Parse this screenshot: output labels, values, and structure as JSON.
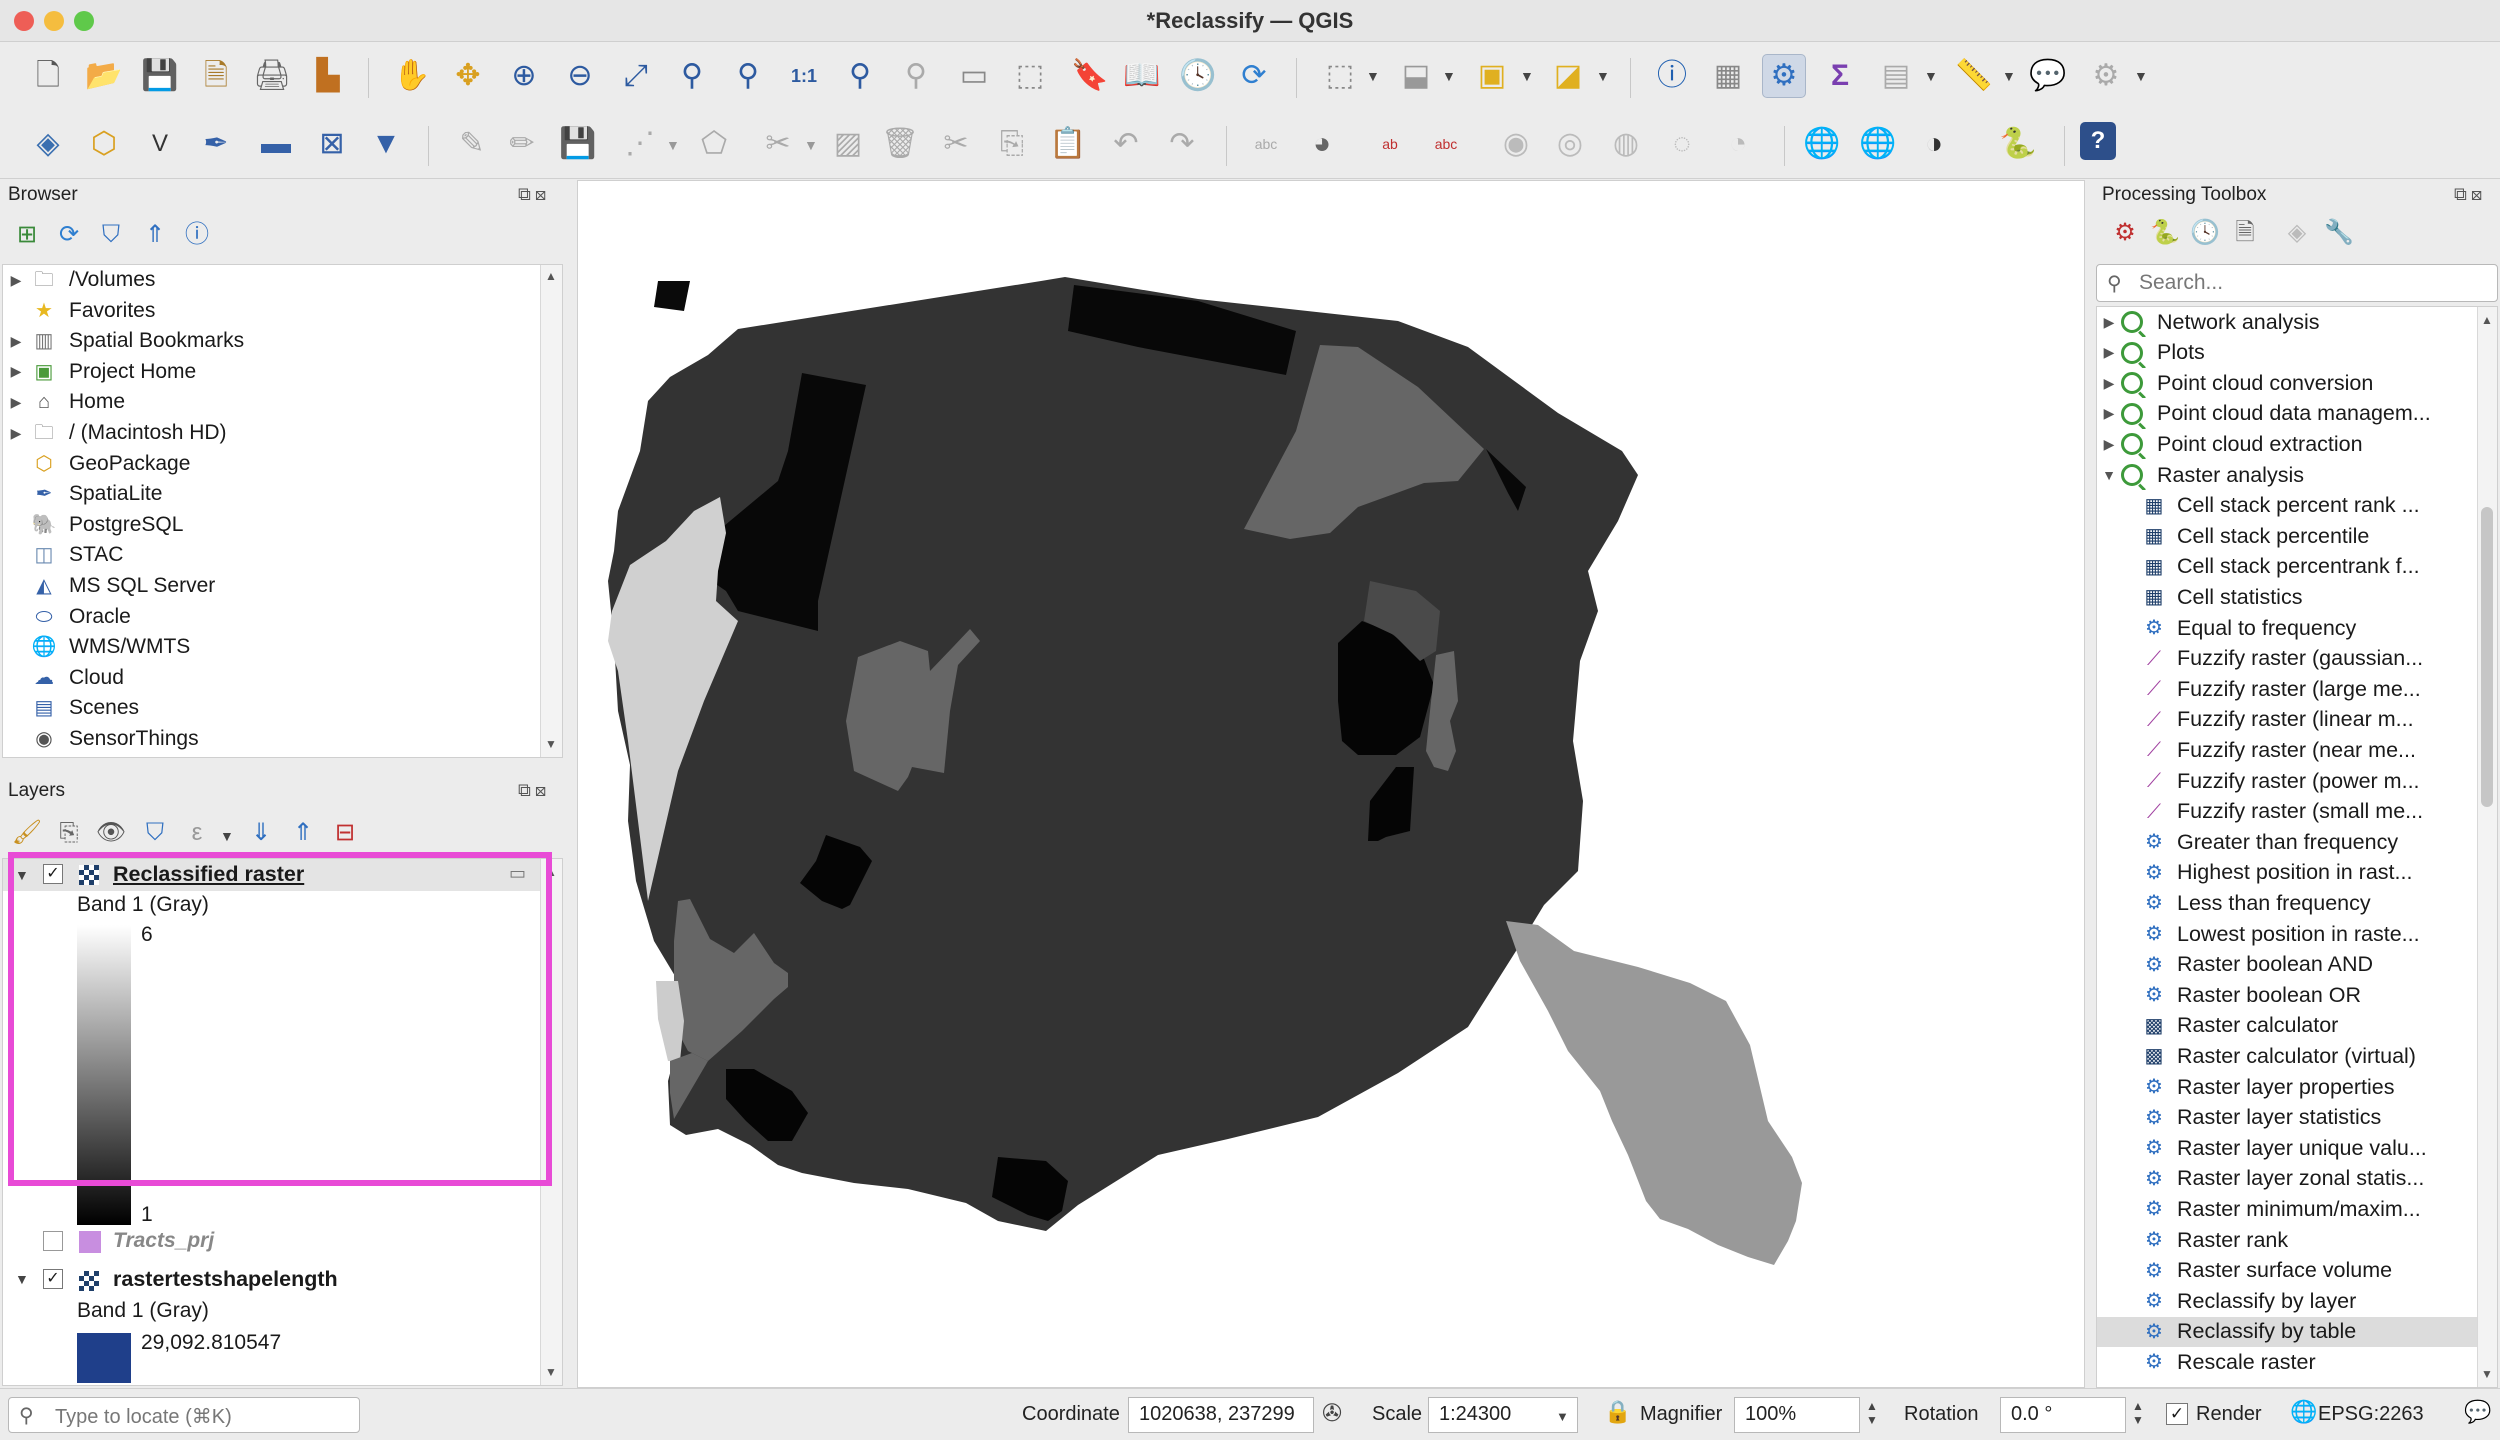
{
  "window": {
    "title": "*Reclassify — QGIS"
  },
  "toolbar1": {
    "icons": [
      "new-project-icon",
      "open-project-icon",
      "save-project-icon",
      "save-as-icon",
      "print-layout-icon",
      "style-manager-icon",
      "pan-icon",
      "pan-to-selection-icon",
      "zoom-in-icon",
      "zoom-out-icon",
      "zoom-full-icon",
      "zoom-to-selection-icon",
      "zoom-to-layer-icon",
      "zoom-native-icon",
      "zoom-last-icon",
      "zoom-next-icon",
      "new-map-view-icon",
      "new-3d-view-icon",
      "temporal-controller-icon",
      "new-bookmark-icon",
      "show-bookmarks-icon",
      "refresh-icon",
      "select-features-icon",
      "deselect-icon",
      "select-by-value-icon",
      "identify-icon",
      "attribute-table-icon",
      "processing-toolbox-icon",
      "statistics-icon",
      "field-calculator-icon",
      "measure-icon",
      "map-tips-icon",
      "settings-icon"
    ]
  },
  "toolbar2": {
    "icons": [
      "data-source-manager-icon",
      "new-geopackage-icon",
      "new-shapefile-icon",
      "new-spatialite-icon",
      "new-temp-layer-icon",
      "new-virtual-layer-icon",
      "add-vector-icon",
      "toggle-editing-icon",
      "pencil-icon",
      "save-edits-icon",
      "digitize-icon",
      "vertex-tool-icon",
      "modify-icon",
      "delete-icon",
      "cut-icon",
      "copy-icon",
      "paste-icon",
      "undo-icon",
      "redo-icon",
      "label-icon",
      "layer-diagram-icon",
      "label-toolbar-icon",
      "label-highlight-icon",
      "pin-label-icon",
      "show-label-icon",
      "move-label-icon",
      "rotate-label-icon",
      "change-label-icon",
      "add-wms-icon",
      "add-wfs-icon",
      "plugin-icon",
      "python-icon",
      "help-icon"
    ]
  },
  "browser": {
    "title": "Browser",
    "items": [
      {
        "label": "/Volumes",
        "icon": "folder-icon",
        "expandable": true
      },
      {
        "label": "Favorites",
        "icon": "star-icon",
        "expandable": false
      },
      {
        "label": "Spatial Bookmarks",
        "icon": "bookmark-icon",
        "expandable": true
      },
      {
        "label": "Project Home",
        "icon": "project-home-icon",
        "expandable": true
      },
      {
        "label": "Home",
        "icon": "home-icon",
        "expandable": true
      },
      {
        "label": "/ (Macintosh HD)",
        "icon": "drive-icon",
        "expandable": true
      },
      {
        "label": "GeoPackage",
        "icon": "geopackage-icon",
        "expandable": false
      },
      {
        "label": "SpatiaLite",
        "icon": "spatialite-icon",
        "expandable": false
      },
      {
        "label": "PostgreSQL",
        "icon": "postgresql-icon",
        "expandable": false
      },
      {
        "label": "STAC",
        "icon": "stac-icon",
        "expandable": false
      },
      {
        "label": "MS SQL Server",
        "icon": "mssql-icon",
        "expandable": false
      },
      {
        "label": "Oracle",
        "icon": "oracle-icon",
        "expandable": false
      },
      {
        "label": "WMS/WMTS",
        "icon": "wms-icon",
        "expandable": false
      },
      {
        "label": "Cloud",
        "icon": "cloud-icon",
        "expandable": false
      },
      {
        "label": "Scenes",
        "icon": "scenes-icon",
        "expandable": false
      },
      {
        "label": "SensorThings",
        "icon": "sensorthings-icon",
        "expandable": false
      }
    ]
  },
  "layers": {
    "title": "Layers",
    "layer1": {
      "name": "Reclassified raster",
      "band": "Band 1 (Gray)",
      "max": "6",
      "min": "1"
    },
    "layer2": {
      "name": "Tracts_prj"
    },
    "layer3": {
      "name": "rastertestshapelength",
      "band": "Band 1 (Gray)",
      "value": "29,092.810547"
    },
    "highlight_color": "#e84bd6"
  },
  "toolbox": {
    "title": "Processing Toolbox",
    "search_placeholder": "Search...",
    "groups": [
      "Network analysis",
      "Plots",
      "Point cloud conversion",
      "Point cloud data managem...",
      "Point cloud extraction",
      "Raster analysis"
    ],
    "algorithms": [
      {
        "label": "Cell stack percent rank ...",
        "icon": "grid-icon"
      },
      {
        "label": "Cell stack percentile",
        "icon": "grid-icon"
      },
      {
        "label": "Cell stack percentrank f...",
        "icon": "grid-icon"
      },
      {
        "label": "Cell statistics",
        "icon": "grid-icon"
      },
      {
        "label": "Equal to frequency",
        "icon": "gear-icon"
      },
      {
        "label": "Fuzzify raster (gaussian...",
        "icon": "fuzzy-icon"
      },
      {
        "label": "Fuzzify raster (large me...",
        "icon": "fuzzy-icon"
      },
      {
        "label": "Fuzzify raster (linear m...",
        "icon": "fuzzy-icon"
      },
      {
        "label": "Fuzzify raster (near me...",
        "icon": "fuzzy-icon"
      },
      {
        "label": "Fuzzify raster (power m...",
        "icon": "fuzzy-icon"
      },
      {
        "label": "Fuzzify raster (small me...",
        "icon": "fuzzy-icon"
      },
      {
        "label": "Greater than frequency",
        "icon": "gear-icon"
      },
      {
        "label": "Highest position in rast...",
        "icon": "gear-icon"
      },
      {
        "label": "Less than frequency",
        "icon": "gear-icon"
      },
      {
        "label": "Lowest position in raste...",
        "icon": "gear-icon"
      },
      {
        "label": "Raster boolean AND",
        "icon": "gear-icon"
      },
      {
        "label": "Raster boolean OR",
        "icon": "gear-icon"
      },
      {
        "label": "Raster calculator",
        "icon": "raster-calc-icon"
      },
      {
        "label": "Raster calculator (virtual)",
        "icon": "raster-calc-icon"
      },
      {
        "label": "Raster layer properties",
        "icon": "gear-icon"
      },
      {
        "label": "Raster layer statistics",
        "icon": "gear-icon"
      },
      {
        "label": "Raster layer unique valu...",
        "icon": "gear-icon"
      },
      {
        "label": "Raster layer zonal statis...",
        "icon": "gear-icon"
      },
      {
        "label": "Raster minimum/maxim...",
        "icon": "gear-icon"
      },
      {
        "label": "Raster rank",
        "icon": "gear-icon"
      },
      {
        "label": "Raster surface volume",
        "icon": "gear-icon"
      },
      {
        "label": "Reclassify by layer",
        "icon": "gear-icon"
      },
      {
        "label": "Reclassify by table",
        "icon": "gear-icon",
        "selected": true
      },
      {
        "label": "Rescale raster",
        "icon": "gear-icon"
      }
    ]
  },
  "statusbar": {
    "locate_placeholder": "Type to locate (⌘K)",
    "coordinate_label": "Coordinate",
    "coordinate_value": "1020638, 237299",
    "scale_label": "Scale",
    "scale_value": "1:24300",
    "magnifier_label": "Magnifier",
    "magnifier_value": "100%",
    "rotation_label": "Rotation",
    "rotation_value": "0.0 °",
    "render_label": "Render",
    "crs": "EPSG:2263"
  }
}
